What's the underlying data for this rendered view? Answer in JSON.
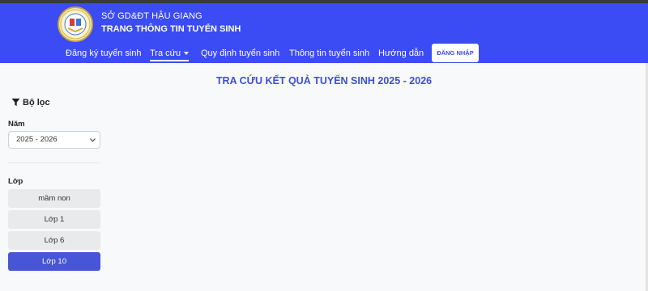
{
  "header": {
    "org_name": "SỞ GD&ĐT HẬU GIANG",
    "site_title": "TRANG THÔNG TIN TUYỂN SINH",
    "logo_icon": "school-emblem-icon",
    "accent_color": "#3b4cf4"
  },
  "nav": {
    "items": [
      {
        "label": "Đăng ký tuyển sinh"
      },
      {
        "label": "Tra cứu",
        "active": true,
        "has_dropdown": true
      },
      {
        "label": "Quy định tuyển sinh"
      },
      {
        "label": "Thông tin tuyển sinh"
      },
      {
        "label": "Hướng dẫn"
      }
    ],
    "login_label": "ĐĂNG NHẬP"
  },
  "main": {
    "title": "TRA CỨU KẾT QUẢ TUYỂN SINH 2025 - 2026"
  },
  "filter": {
    "heading": "Bộ lọc",
    "heading_icon": "filter-icon",
    "year_label": "Năm",
    "year_value": "2025 - 2026",
    "grade_label": "Lớp",
    "grades": [
      {
        "label": "mầm non"
      },
      {
        "label": "Lớp 1"
      },
      {
        "label": "Lớp 6"
      },
      {
        "label": "Lớp 10",
        "selected": true
      }
    ],
    "selected_color": "#4755d6"
  }
}
